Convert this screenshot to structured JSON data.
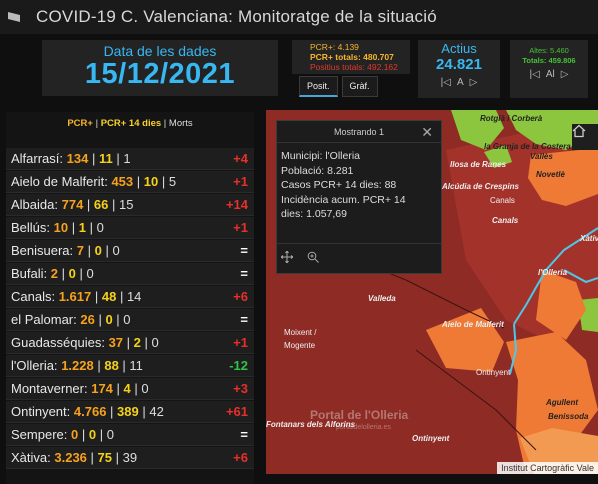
{
  "app": {
    "title": "COVID-19 C. Valenciana: Monitoratge de la situació"
  },
  "date_panel": {
    "label": "Data de les dades",
    "value": "15/12/2021"
  },
  "pcr_panel": {
    "pcr": "PCR+: 4.139",
    "pcr_totals": "PCR+ totals: 480.707",
    "positius_totals": "Positius totals: 492.162"
  },
  "tabs": [
    {
      "label": "Posit.",
      "active": true
    },
    {
      "label": "Gràf.",
      "active": false
    }
  ],
  "actius": {
    "label": "Actius",
    "value": "24.821",
    "page": "A"
  },
  "altes": {
    "altes": "Altes: 5.460",
    "totals": "Totals: 459.806",
    "page": "Al"
  },
  "list": {
    "header": {
      "pcr": "PCR+",
      "pcr14": "PCR+ 14 dies",
      "morts": "Morts",
      "sep": "|"
    },
    "rows": [
      {
        "name": "Alfarrasí:",
        "pcr": "134",
        "pcr14": "11",
        "morts": "1",
        "change": "+4",
        "dir": "up"
      },
      {
        "name": "Aielo de Malferit:",
        "pcr": "453",
        "pcr14": "10",
        "morts": "5",
        "change": "+1",
        "dir": "up"
      },
      {
        "name": "Albaida:",
        "pcr": "774",
        "pcr14": "66",
        "morts": "15",
        "change": "+14",
        "dir": "up"
      },
      {
        "name": "Bellús:",
        "pcr": "10",
        "pcr14": "1",
        "morts": "0",
        "change": "+1",
        "dir": "up"
      },
      {
        "name": "Benisuera:",
        "pcr": "7",
        "pcr14": "0",
        "morts": "0",
        "change": "=",
        "dir": "eq"
      },
      {
        "name": "Bufali:",
        "pcr": "2",
        "pcr14": "0",
        "morts": "0",
        "change": "=",
        "dir": "eq"
      },
      {
        "name": "Canals:",
        "pcr": "1.617",
        "pcr14": "48",
        "morts": "14",
        "change": "+6",
        "dir": "up"
      },
      {
        "name": "el Palomar:",
        "pcr": "26",
        "pcr14": "0",
        "morts": "0",
        "change": "=",
        "dir": "eq"
      },
      {
        "name": "Guadasséquies:",
        "pcr": "37",
        "pcr14": "2",
        "morts": "0",
        "change": "+1",
        "dir": "up"
      },
      {
        "name": "l'Olleria:",
        "pcr": "1.228",
        "pcr14": "88",
        "morts": "11",
        "change": "-12",
        "dir": "down"
      },
      {
        "name": "Montaverner:",
        "pcr": "174",
        "pcr14": "4",
        "morts": "0",
        "change": "+3",
        "dir": "up"
      },
      {
        "name": "Ontinyent:",
        "pcr": "4.766",
        "pcr14": "389",
        "morts": "42",
        "change": "+61",
        "dir": "up"
      },
      {
        "name": "Sempere:",
        "pcr": "0",
        "pcr14": "0",
        "morts": "0",
        "change": "=",
        "dir": "eq"
      },
      {
        "name": "Xàtiva:",
        "pcr": "3.236",
        "pcr14": "75",
        "morts": "39",
        "change": "+6",
        "dir": "up"
      }
    ]
  },
  "popup": {
    "title": "Mostrando 1",
    "close_icon": "close-icon",
    "lines": [
      "Municipi: l'Olleria",
      "Població: 8.281",
      "Casos PCR+ 14 dies: 88",
      "Incidència acum. PCR+ 14",
      "dies: 1.057,69"
    ],
    "actions": [
      "pan-icon",
      "zoom-to-icon"
    ]
  },
  "map": {
    "labels": {
      "rotgla": "Rotglà i Corberà",
      "granja": "la Granja de la Costera",
      "valles": "Vallès",
      "novetle": "Novetlè",
      "llosa": "llosa de Ranes",
      "alcudia": "Alcúdia de Crespins",
      "canals_top": "Canals",
      "canals": "Canals",
      "xativa": "Xàtiva",
      "olleria": "l'Olleria",
      "valleda": "Valleda",
      "aielo": "Aielo de Malferit",
      "moixent": "Moixent /",
      "mogente": "Mogente",
      "ontinyent": "Ontinyent",
      "ontinyent2": "Ontinyent",
      "agullent": "Agullent",
      "benissoda": "Benissoda",
      "alforins": "Fontanars dels Alforins",
      "watermark": "Portal de l'Olleria",
      "watermark_sub": "portaldelolleria.es"
    },
    "attribution": "Institut Cartogràfic Vale",
    "home_icon": "home-icon",
    "colors": {
      "dark_red": "#8e2b25",
      "red": "#a3332a",
      "orange": "#ee7a35",
      "light_orange": "#f29a52",
      "green": "#8cc63e",
      "cyan": "#4cc8e8"
    }
  },
  "colors": {
    "accent_blue": "#38b8f2",
    "pcr_orange": "#f7a21c",
    "pcr14_yellow": "#f5d21a",
    "up_red": "#e8302a",
    "down_green": "#31c24a"
  }
}
